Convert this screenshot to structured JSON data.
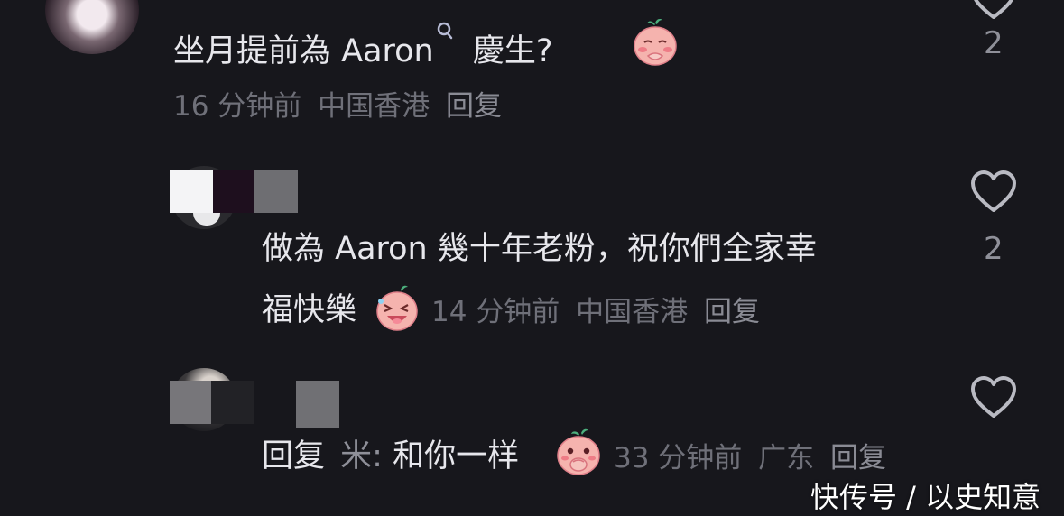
{
  "comments": [
    {
      "id": "c1",
      "text": "坐月提前為 Aaron",
      "text_after_icon": "慶生?",
      "time": "16 分钟前",
      "location": "中国香港",
      "reply_label": "回复",
      "like_count": "2",
      "emoji": "shy-face-emoji"
    },
    {
      "id": "c2",
      "text_line1": "做為 Aaron 幾十年老粉，祝你們全家幸",
      "text_line2": "福快樂",
      "time": "14 分钟前",
      "location": "中国香港",
      "reply_label": "回复",
      "like_count": "2",
      "emoji": "laughing-face-emoji"
    },
    {
      "id": "c3",
      "reply_prefix": "回复",
      "reply_to": "米:",
      "text": "和你一样",
      "time": "33 分钟前",
      "location": "广东",
      "reply_label": "回复",
      "emoji": "covering-mouth-face-emoji"
    }
  ],
  "watermark": "快传号 / 以史知意",
  "colors": {
    "background": "#17171c",
    "primary_text": "#e7e7ec",
    "secondary_text": "#6f7079",
    "emoji_pink": "#f3a6a6",
    "emoji_leaf": "#4caf7d"
  }
}
